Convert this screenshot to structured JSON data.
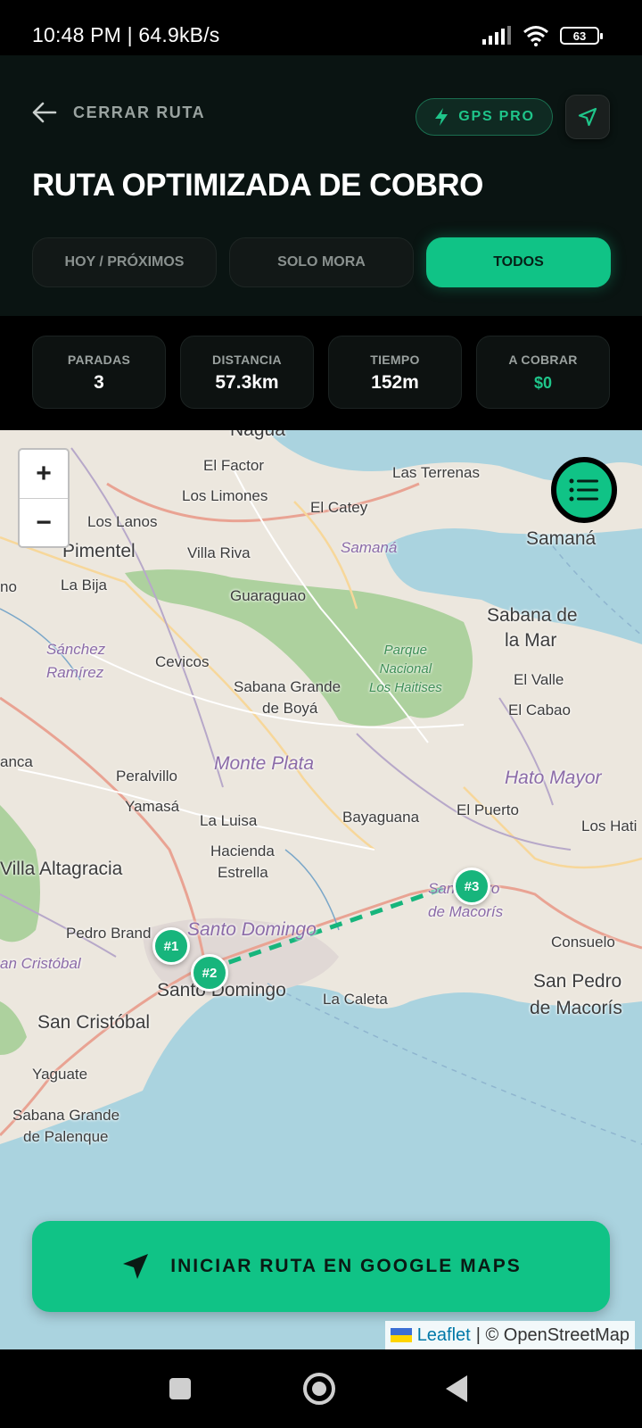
{
  "status_bar": {
    "time": "10:48 PM | 64.9kB/s",
    "battery": "63"
  },
  "header": {
    "back_label": "CERRAR RUTA",
    "gps_badge": "GPS PRO",
    "title": "RUTA OPTIMIZADA DE COBRO",
    "tabs": [
      {
        "label": "HOY / PRÓXIMOS",
        "active": false
      },
      {
        "label": "SOLO MORA",
        "active": false
      },
      {
        "label": "TODOS",
        "active": true
      }
    ]
  },
  "stats": [
    {
      "label": "PARADAS",
      "value": "3"
    },
    {
      "label": "DISTANCIA",
      "value": "57.3km"
    },
    {
      "label": "TIEMPO",
      "value": "152m"
    },
    {
      "label": "A COBRAR",
      "value": "$0"
    }
  ],
  "map": {
    "zoom_in": "+",
    "zoom_out": "−",
    "places": {
      "nagua": "Nagua",
      "el_factor": "El Factor",
      "las_terrenas": "Las Terrenas",
      "los_limones": "Los Limones",
      "el_catey": "El Catey",
      "los_lanos": "Los Lanos",
      "pimentel": "Pimentel",
      "villa_riva": "Villa Riva",
      "samana_region": "Samaná",
      "samana": "Samaná",
      "no": "no",
      "la_bija": "La Bija",
      "guaraguao": "Guaraguao",
      "sabana_de_la_mar_1": "Sabana de",
      "sabana_de_la_mar_2": "la Mar",
      "sanchez_ramirez_1": "Sánchez",
      "sanchez_ramirez_2": "Ramírez",
      "cevicos": "Cevicos",
      "parque_1": "Parque",
      "parque_2": "Nacional",
      "parque_3": "Los Haitises",
      "el_valle": "El Valle",
      "sabana_grande_boya_1": "Sabana Grande",
      "sabana_grande_boya_2": "de Boyá",
      "el_cabao": "El Cabao",
      "anca": "anca",
      "monte_plata": "Monte Plata",
      "peralvillo": "Peralvillo",
      "hato_mayor": "Hato Mayor",
      "yamasa": "Yamasá",
      "el_puerto": "El Puerto",
      "la_luisa": "La Luisa",
      "bayaguana": "Bayaguana",
      "los_hati": "Los Hati",
      "hacienda_estrella_1": "Hacienda",
      "hacienda_estrella_2": "Estrella",
      "villa_altagracia": "Villa Altagracia",
      "spm_region_1": "San Pedro",
      "spm_region_2": "de Macorís",
      "pedro_brand": "Pedro Brand",
      "santo_domingo_region": "Santo Domingo",
      "consuelo": "Consuelo",
      "san_cristobal_region": "an Cristóbal",
      "santo_domingo": "Santo Domingo",
      "la_caleta": "La Caleta",
      "san_pedro_1": "San Pedro",
      "san_pedro_2": "de Macorís",
      "san_cristobal": "San Cristóbal",
      "yaguate": "Yaguate",
      "sabana_grande_palenque_1": "Sabana Grande",
      "sabana_grande_palenque_2": "de Palenque"
    },
    "markers": [
      "#1",
      "#2",
      "#3"
    ],
    "cta_label": "INICIAR RUTA EN GOOGLE MAPS",
    "attribution_link": "Leaflet",
    "attribution_text": "| © OpenStreetMap"
  },
  "colors": {
    "accent": "#10c386",
    "header_bg": "#0a1412",
    "water": "#aad3df",
    "park": "#9ccb8b"
  }
}
